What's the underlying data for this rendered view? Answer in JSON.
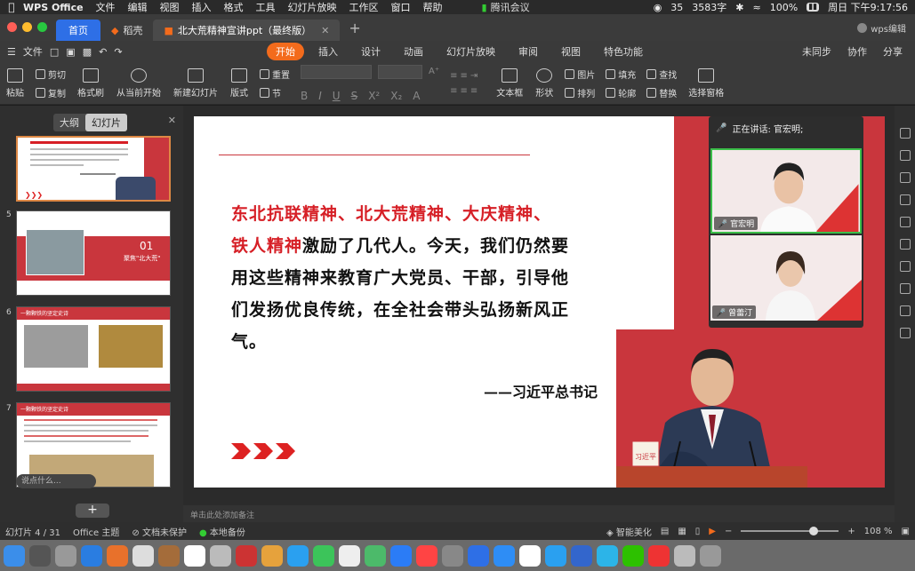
{
  "menubar": {
    "app": "WPS Office",
    "items": [
      "文件",
      "编辑",
      "视图",
      "插入",
      "格式",
      "工具",
      "幻灯片放映",
      "工作区",
      "窗口",
      "帮助"
    ],
    "meeting": "腾讯会议",
    "wechat_count": "35",
    "unread": "3583字",
    "battery": "100%",
    "datetime": "周日 下午9:17:56"
  },
  "tabs": {
    "home": "首页",
    "daoke": "稻壳",
    "doc": "北大荒精神宣讲ppt（最终版）",
    "wps_edit": "wps编辑"
  },
  "ribbon": {
    "file": "文件",
    "tabs": [
      "开始",
      "插入",
      "设计",
      "动画",
      "幻灯片放映",
      "审阅",
      "视图",
      "特色功能"
    ],
    "right": [
      "未同步",
      "协作",
      "分享"
    ]
  },
  "toolbar": {
    "paste": "粘贴",
    "cut": "剪切",
    "copy": "复制",
    "format_painter": "格式刷",
    "from_current": "从当前开始",
    "new_slide": "新建幻灯片",
    "layout": "版式",
    "reset": "重置",
    "section": "节",
    "textbox": "文本框",
    "shape": "形状",
    "picture": "图片",
    "arrange": "排列",
    "fill": "填充",
    "outline": "轮廓",
    "find": "查找",
    "replace": "替换",
    "select_pane": "选择窗格"
  },
  "leftpanel": {
    "tab_outline": "大纲",
    "tab_slides": "幻灯片",
    "slide_numbers": [
      "5",
      "6",
      "7"
    ],
    "thumb5_title": "01",
    "thumb5_sub": "聚焦\"北大荒\"",
    "thumb6_title": "一颗颗铁的坚定史诗",
    "thumb7_title": "一颗颗铁的坚定史诗",
    "say_placeholder": "说点什么...",
    "add": "+"
  },
  "slide": {
    "quote_red1": "东北抗联精神、北大荒精神、大庆精神、",
    "quote_red2": "铁人精神",
    "quote_rest1": "激励了几代人。今天，我们仍然要",
    "quote_rest2": "用这些精神来教育广大党员、干部，引导他",
    "quote_rest3": "们发扬优良传统，在全社会带头弘扬新风正",
    "quote_rest4": "气。",
    "author": "——习近平总书记",
    "nameplate": "习近平"
  },
  "meeting": {
    "speaking": "正在讲话: 官宏明;",
    "participant1": "官宏明",
    "participant2": "曾蕾汀"
  },
  "notes": {
    "placeholder": "单击此处添加备注"
  },
  "status": {
    "slide_pos": "幻灯片 4 / 31",
    "theme": "Office 主题",
    "unprotected": "文档未保护",
    "backup": "本地备份",
    "beautify": "智能美化",
    "zoom": "108 %",
    "zoom_fraction": 0.7
  },
  "colors": {
    "accent_red": "#c9363d",
    "quote_red": "#d61f26",
    "wps_orange": "#f36b1c",
    "home_blue": "#2e6fe6"
  }
}
